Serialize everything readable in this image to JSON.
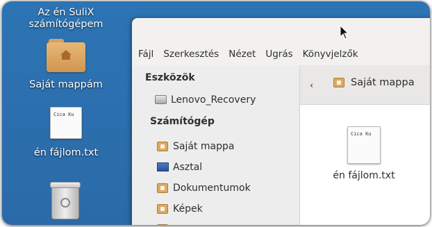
{
  "desktop": {
    "computer_label": "Az én SuliX\nszámítógépem",
    "home_label": "Saját mappám",
    "file_label": "én fájlom.txt",
    "file_preview": "Cica Ku"
  },
  "window": {
    "menu": [
      "Fájl",
      "Szerkesztés",
      "Nézet",
      "Ugrás",
      "Könyvjelzők"
    ],
    "sidebar": {
      "devices_heading": "Eszközök",
      "devices": [
        {
          "label": "Lenovo_Recovery",
          "icon": "drive-icon"
        }
      ],
      "computer_heading": "Számítógép",
      "places": [
        {
          "label": "Saját mappa",
          "icon": "home-folder-icon"
        },
        {
          "label": "Asztal",
          "icon": "desktop-icon"
        },
        {
          "label": "Dokumentumok",
          "icon": "documents-folder-icon"
        },
        {
          "label": "Képek",
          "icon": "pictures-folder-icon"
        }
      ]
    },
    "pathbar": {
      "back": "‹",
      "crumb": "Saját mappa"
    },
    "files": [
      {
        "label": "én fájlom.txt",
        "preview": "Cica Ku"
      }
    ]
  },
  "colors": {
    "desktop_bg": "#2b6fae",
    "folder": "#dfa862",
    "window_bg": "#f2f1f0"
  }
}
